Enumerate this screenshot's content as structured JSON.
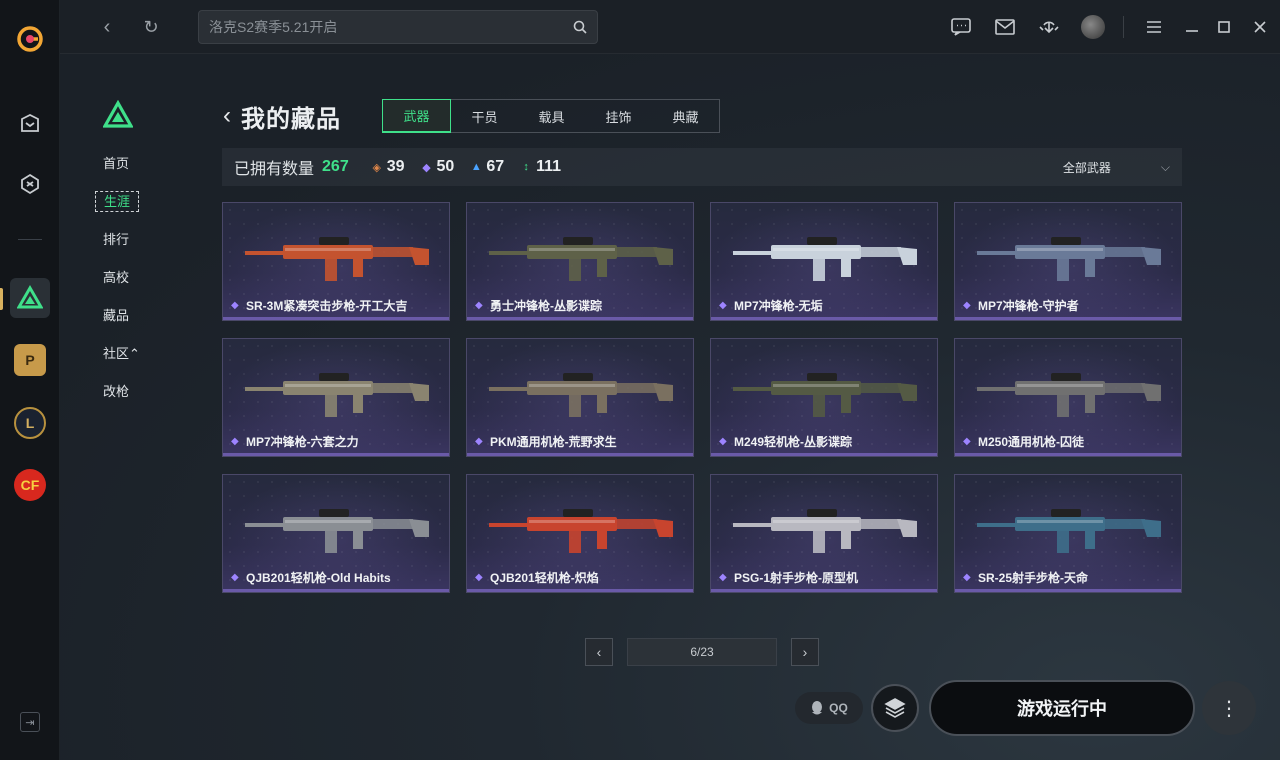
{
  "search": {
    "placeholder": "洛克S2赛季5.21开启"
  },
  "subnav": {
    "items": [
      {
        "label": "首页",
        "active": false
      },
      {
        "label": "生涯",
        "active": true
      },
      {
        "label": "排行",
        "active": false
      },
      {
        "label": "高校",
        "active": false
      },
      {
        "label": "藏品",
        "active": false
      },
      {
        "label": "社区⌃",
        "active": false
      },
      {
        "label": "改枪",
        "active": false
      }
    ]
  },
  "header": {
    "title": "我的藏品"
  },
  "tabs": [
    {
      "label": "武器",
      "active": true
    },
    {
      "label": "干员",
      "active": false
    },
    {
      "label": "载具",
      "active": false
    },
    {
      "label": "挂饰",
      "active": false
    },
    {
      "label": "典藏",
      "active": false
    }
  ],
  "stats": {
    "label": "已拥有数量",
    "total": "267",
    "gold": "39",
    "purple": "50",
    "blue": "67",
    "green": "111",
    "filter": "全部武器",
    "colors": {
      "gold": "#e0874a",
      "purple": "#9d84ff",
      "blue": "#4aa3ff",
      "green": "#3fe08a"
    }
  },
  "cards": [
    {
      "name": "SR-3M紧凑突击步枪-开工大吉",
      "gun_color": "#c4532f"
    },
    {
      "name": "勇士冲锋枪-丛影谍踪",
      "gun_color": "#5e6148"
    },
    {
      "name": "MP7冲锋枪-无垢",
      "gun_color": "#c9d2dc"
    },
    {
      "name": "MP7冲锋枪-守护者",
      "gun_color": "#6a7a98"
    },
    {
      "name": "MP7冲锋枪-六套之力",
      "gun_color": "#8a8470"
    },
    {
      "name": "PKM通用机枪-荒野求生",
      "gun_color": "#7a7060"
    },
    {
      "name": "M249轻机枪-丛影谍踪",
      "gun_color": "#545a44"
    },
    {
      "name": "M250通用机枪-囚徒",
      "gun_color": "#707070"
    },
    {
      "name": "QJB201轻机枪-Old Habits",
      "gun_color": "#8a8e94"
    },
    {
      "name": "QJB201轻机枪-炽焰",
      "gun_color": "#c8442e"
    },
    {
      "name": "PSG-1射手步枪-原型机",
      "gun_color": "#b8b8c0"
    },
    {
      "name": "SR-25射手步枪-天命",
      "gun_color": "#3e6e8a"
    }
  ],
  "pager": {
    "indicator": "6/23"
  },
  "bottom": {
    "qq_label": "QQ",
    "play_label": "游戏运行中"
  }
}
